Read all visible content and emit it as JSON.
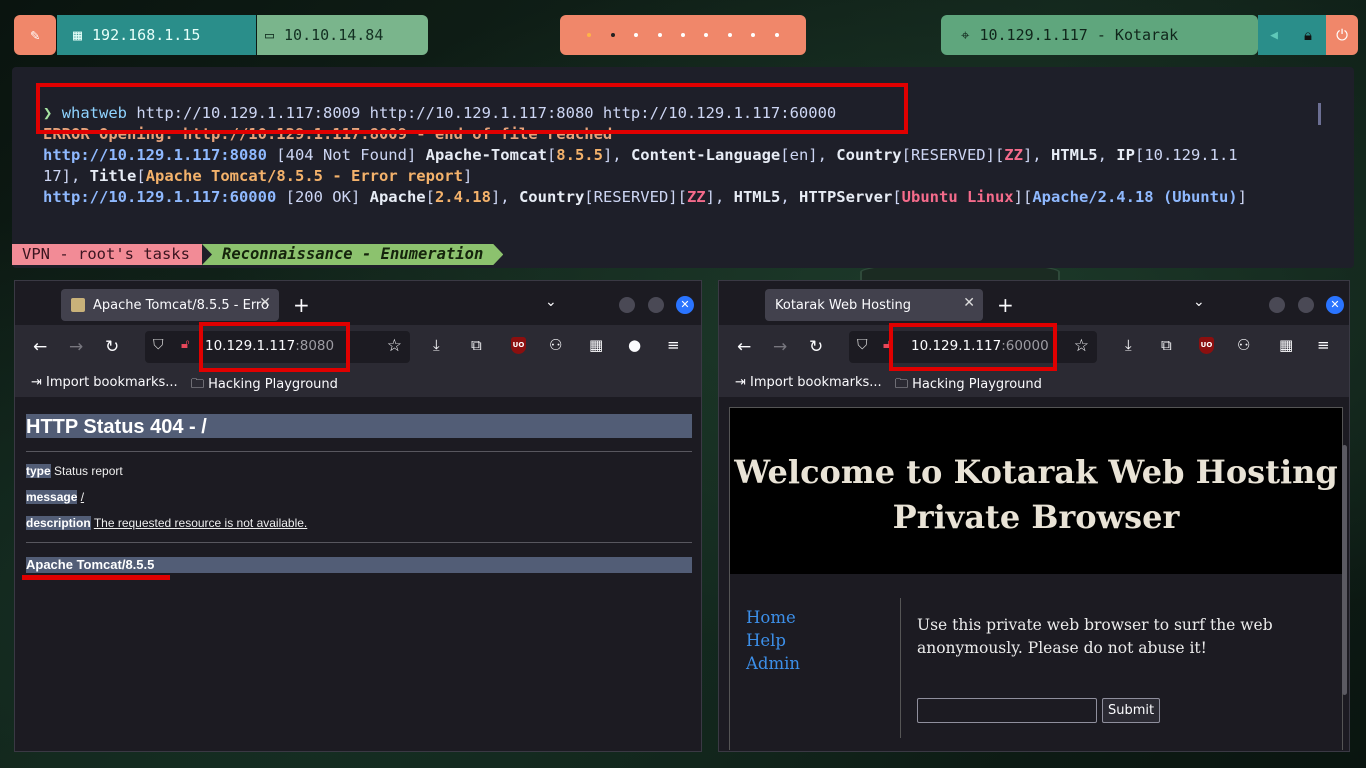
{
  "topbar": {
    "lan_ip": "192.168.1.15",
    "vpn_ip": "10.10.14.84",
    "target": "10.129.1.117 - Kotarak",
    "workspaces": 9
  },
  "terminal": {
    "prompt": "❯",
    "command": "whatweb",
    "args": " http://10.129.1.117:8009 http://10.129.1.117:8080 http://10.129.1.117:60000",
    "error_line": "ERROR Opening: http://10.129.1.117:8009 - end of file reached",
    "l2": {
      "url": "http://10.129.1.117:8080",
      "status": " [404 Not Found] ",
      "p1": "Apache-Tomcat",
      "v1": "8.5.5",
      "p2": "Content-Language",
      "v2": "en",
      "p3": "Country",
      "v3": "RESERVED",
      "v3b": "ZZ",
      "p4": "HTML5",
      "p5": "IP",
      "v5": "10.129.1.1"
    },
    "l3": {
      "wrap": "17",
      "p6": "Title",
      "v6": "Apache Tomcat/8.5.5 - Error report"
    },
    "l4": {
      "url": "http://10.129.1.117:60000",
      "status": " [200 OK] ",
      "p1": "Apache",
      "v1": "2.4.18",
      "p2": "Country",
      "v2": "RESERVED",
      "v2b": "ZZ",
      "p3": "HTML5",
      "p4": "HTTPServer",
      "v4": "Ubuntu Linux",
      "v4b": "Apache/2.4.18 (Ubuntu)"
    },
    "status_left": "VPN - root's tasks",
    "status_right": "Reconnaissance - Enumeration"
  },
  "left_browser": {
    "tab_title": "Apache Tomcat/8.5.5 - Erro",
    "url_host": "10.129.1.117",
    "url_port": ":8080",
    "bookmark1": "Import bookmarks...",
    "bookmark2": "Hacking Playground",
    "page": {
      "heading": "HTTP Status 404 - /",
      "type_label": "type",
      "type_value": " Status report",
      "message_label": "message",
      "message_value": "/",
      "description_label": "description",
      "description_value": "The requested resource is not available.",
      "footer": "Apache Tomcat/8.5.5"
    }
  },
  "right_browser": {
    "tab_title": "Kotarak Web Hosting",
    "url_host": "10.129.1.117",
    "url_port": ":60000",
    "bookmark1": "Import bookmarks...",
    "bookmark2": "Hacking Playground",
    "page": {
      "banner_line1": "Welcome to Kotarak Web Hosting",
      "banner_line2": "Private Browser",
      "nav": [
        "Home",
        "Help",
        "Admin"
      ],
      "text": "Use this private web browser to surf the web anonymously. Please do not abuse it!",
      "submit": "Submit"
    }
  }
}
